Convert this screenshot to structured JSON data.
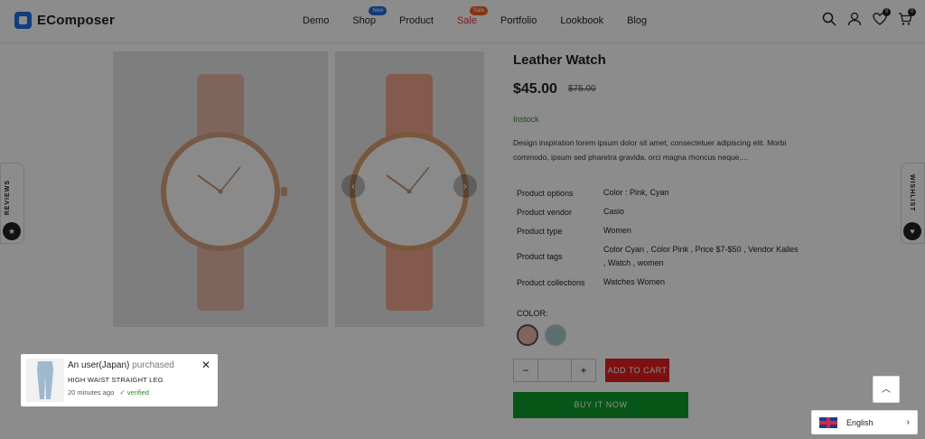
{
  "header": {
    "logo_text": "EComposer",
    "nav": [
      {
        "label": "Demo"
      },
      {
        "label": "Shop",
        "badge": "New"
      },
      {
        "label": "Product"
      },
      {
        "label": "Sale",
        "badge": "Sale"
      },
      {
        "label": "Portfolio"
      },
      {
        "label": "Lookbook"
      },
      {
        "label": "Blog"
      }
    ],
    "wishlist_count": "0",
    "cart_count": "0"
  },
  "side_tabs": {
    "left": "REVIEWS",
    "right": "WISHLIST"
  },
  "product": {
    "title": "Leather Watch",
    "price": "$45.00",
    "compare_price": "$75.00",
    "stock": "Instock",
    "description": "Design inspiration lorem ipsum dolor sit amet, consectetuer adipiscing elit. Morbi commodo, ipsum sed pharetra gravida, orci magna rhoncus neque,...",
    "specs": [
      {
        "key": "Product options",
        "value": "Color : Pink, Cyan"
      },
      {
        "key": "Product vendor",
        "value": "Casio"
      },
      {
        "key": "Product type",
        "value": "Women"
      },
      {
        "key": "Product tags",
        "value": "Color Cyan , Color Pink , Price $7-$50 , Vendor Kalles , Watch , women"
      },
      {
        "key": "Product collections",
        "value": "Watches Women"
      }
    ],
    "color_label": "COLOR:",
    "colors": [
      "#e8b9a6",
      "#a9c9c9"
    ],
    "quantity": "",
    "add_to_cart": "ADD TO CART",
    "buy_now": "BUY IT NOW"
  },
  "popup": {
    "title_prefix": "An user(Japan)",
    "title_suffix": "purchased",
    "product": "HIGH WAIST STRAIGHT LEG",
    "time": "20 minutes ago",
    "verified": "verified"
  },
  "language": {
    "label": "English"
  }
}
